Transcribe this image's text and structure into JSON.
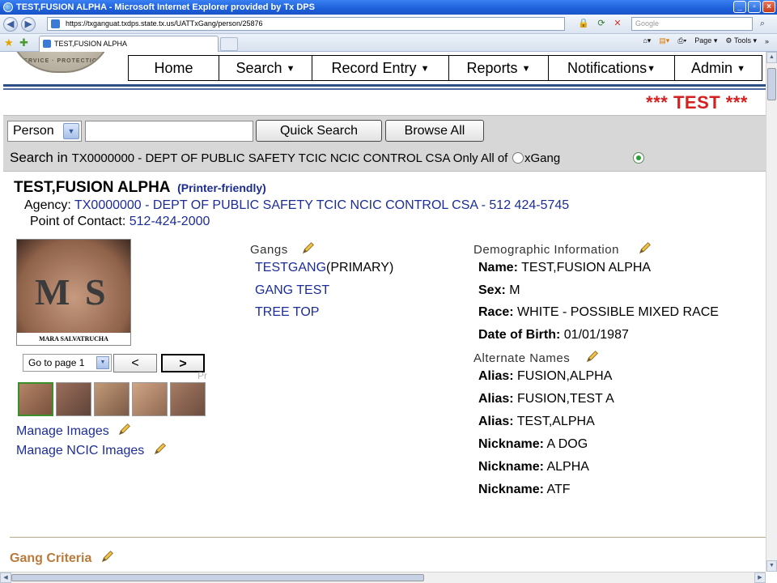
{
  "window": {
    "title": "TEST,FUSION ALPHA - Microsoft Internet Explorer provided by Tx DPS",
    "url": "https://txganguat.txdps.state.tx.us/UATTxGang/person/25876",
    "search_placeholder": "Google",
    "tab_title": "TEST,FUSION ALPHA",
    "cmd_page": "Page",
    "cmd_tools": "Tools"
  },
  "nav": {
    "items": [
      "Home",
      "Search",
      "Record Entry",
      "Reports",
      "Notifications",
      "Admin"
    ],
    "has_caret": [
      false,
      true,
      true,
      true,
      true,
      true
    ]
  },
  "banner": "*** TEST ***",
  "search": {
    "type_value": "Person",
    "quick_label": "Quick Search",
    "browse_label": "Browse All",
    "search_in_prefix": "Search in",
    "agency_text": "TX0000000 - DEPT OF PUBLIC SAFETY TCIC NCIC CONTROL CSA Only All of",
    "txgang_text": "xGang"
  },
  "person": {
    "name": "TEST,FUSION ALPHA",
    "printer_link": "(Printer-friendly)",
    "agency_label": "Agency:",
    "agency_value": "TX0000000 - DEPT OF PUBLIC SAFETY TCIC NCIC CONTROL CSA - 512 424-5745",
    "poc_label": "Point of Contact:",
    "poc_value": "512-424-2000"
  },
  "images": {
    "photo_caption": "MARA SALVATRUCHA",
    "goto_label": "Go to page 1",
    "prev": "<",
    "next": ">",
    "ghost": "Pr",
    "manage_images": "Manage Images",
    "manage_ncic": "Manage NCIC Images"
  },
  "gangs": {
    "title": "Gangs",
    "items": [
      {
        "name": "TESTGANG",
        "suffix": "(PRIMARY)"
      },
      {
        "name": "GANG TEST",
        "suffix": ""
      },
      {
        "name": "TREE TOP",
        "suffix": ""
      }
    ]
  },
  "demographics": {
    "title": "Demographic Information",
    "rows": [
      {
        "label": "Name:",
        "value": "TEST,FUSION ALPHA"
      },
      {
        "label": "Sex:",
        "value": "M"
      },
      {
        "label": "Race:",
        "value": "WHITE - POSSIBLE MIXED RACE"
      },
      {
        "label": "Date of Birth:",
        "value": "01/01/1987"
      }
    ]
  },
  "alternate": {
    "title": "Alternate Names",
    "rows": [
      {
        "label": "Alias:",
        "value": "FUSION,ALPHA"
      },
      {
        "label": "Alias:",
        "value": "FUSION,TEST A"
      },
      {
        "label": "Alias:",
        "value": "TEST,ALPHA"
      },
      {
        "label": "Nickname:",
        "value": "A DOG"
      },
      {
        "label": "Nickname:",
        "value": "ALPHA"
      },
      {
        "label": "Nickname:",
        "value": "ATF"
      }
    ]
  },
  "gang_criteria": "Gang Criteria",
  "colors": {
    "link": "#1c2d99",
    "banner": "#d42020",
    "criteria": "#b97a3b"
  }
}
